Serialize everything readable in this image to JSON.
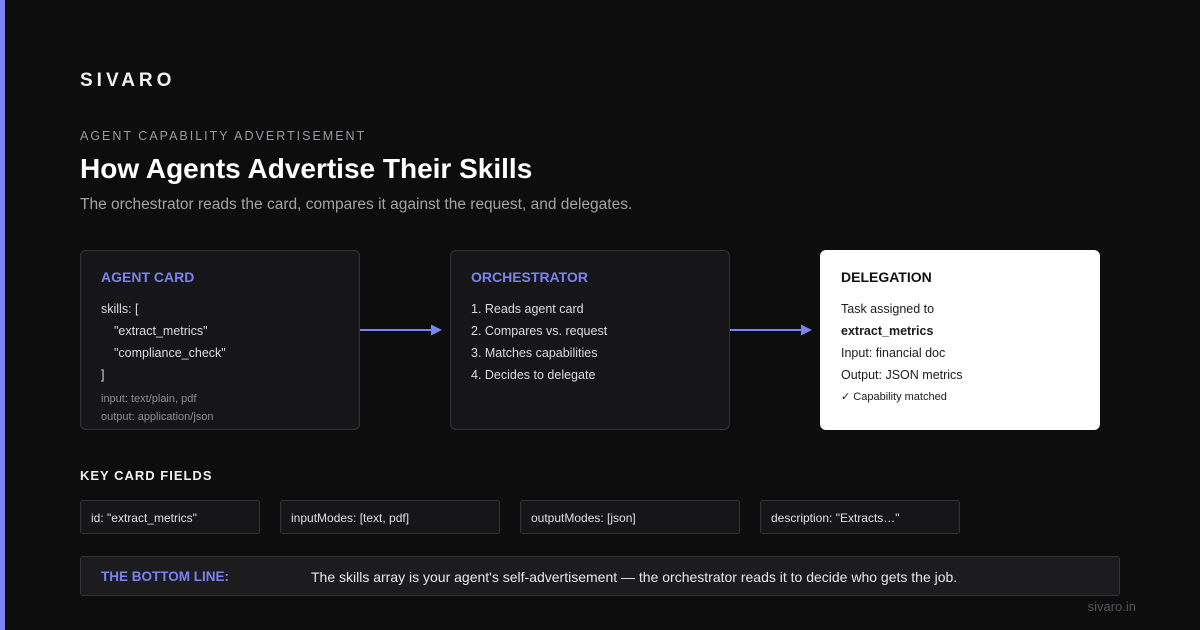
{
  "brand": "SIVARO",
  "eyebrow": "AGENT CAPABILITY ADVERTISEMENT",
  "title": "How Agents Advertise Their Skills",
  "subtitle": "The orchestrator reads the card, compares it against the request, and delegates.",
  "colors": {
    "accent": "#7b83f0",
    "background": "#0d0d0e",
    "card": "#161618"
  },
  "agent_card": {
    "title": "AGENT CARD",
    "lines": [
      "skills: [",
      "\"extract_metrics\"",
      "\"compliance_check\"",
      "]"
    ],
    "meta": [
      "input: text/plain, pdf",
      "output: application/json"
    ]
  },
  "orchestrator": {
    "title": "ORCHESTRATOR",
    "steps": [
      "1. Reads agent card",
      "2. Compares vs. request",
      "3. Matches capabilities",
      "4. Decides to delegate"
    ]
  },
  "delegation": {
    "title": "DELEGATION",
    "lines": [
      "Task assigned to",
      "extract_metrics",
      "Input: financial doc",
      "Output: JSON metrics"
    ],
    "status": "✓ Capability matched"
  },
  "key_fields": {
    "label": "KEY CARD FIELDS",
    "items": [
      "id: \"extract_metrics\"",
      "inputModes: [text, pdf]",
      "outputModes: [json]",
      "description: \"Extracts…\""
    ]
  },
  "bottom_line": {
    "label": "THE BOTTOM LINE:",
    "text": "The skills array is your agent's self-advertisement — the orchestrator reads it to decide who gets the job."
  },
  "footer": "sivaro.in"
}
